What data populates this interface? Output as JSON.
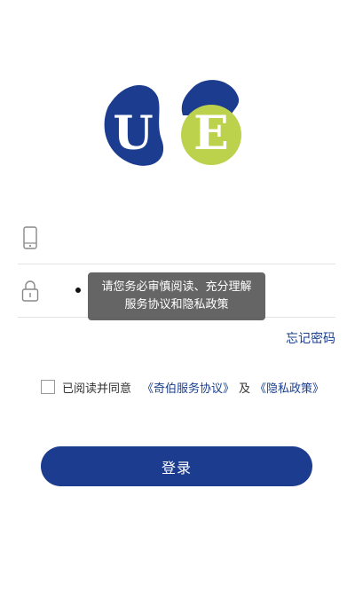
{
  "logo": {
    "letter_u": "U",
    "letter_e": "E",
    "colors": {
      "blue": "#1c3c8f",
      "green": "#bcd14c"
    }
  },
  "phone_field": {
    "icon": "phone-icon",
    "placeholder": ""
  },
  "password_field": {
    "icon": "lock-icon",
    "value_masked": "•"
  },
  "toast": {
    "message": "请您务必审慎阅读、充分理解服务协议和隐私政策"
  },
  "forgot_password": "忘记密码",
  "agreement": {
    "prefix": "已阅读并同意",
    "service_link": "《奇伯服务协议》",
    "and": "及",
    "privacy_link": "《隐私政策》",
    "checked": false
  },
  "login_button": "登录",
  "colors": {
    "accent": "#1c3c8f",
    "link": "#1a3f8f"
  }
}
